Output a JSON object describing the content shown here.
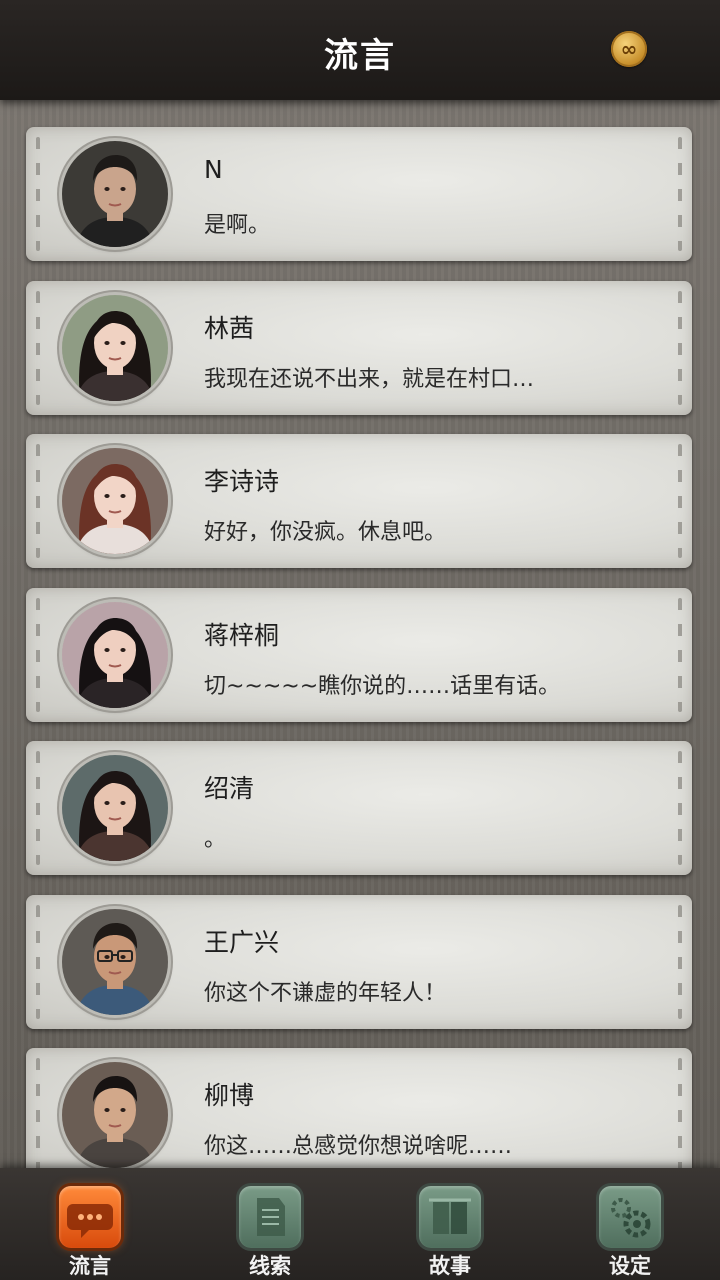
{
  "header": {
    "title": "流言",
    "coin_symbol": "∞",
    "coin_icon": "coin-infinity-icon"
  },
  "messages": [
    {
      "name": "N",
      "text": "是啊。",
      "avatar": "man-dark-portrait",
      "skin": "#c9a48c",
      "hair": "#1d1a18",
      "bg": "#3c3a36",
      "cloth": "#202020"
    },
    {
      "name": "林茜",
      "text": "我现在还说不出来，就是在村口…",
      "avatar": "woman-long-hair",
      "skin": "#f0d2c2",
      "hair": "#1a1412",
      "bg": "#8f9c84",
      "cloth": "#3a3030"
    },
    {
      "name": "李诗诗",
      "text": "好好，你没疯。休息吧。",
      "avatar": "woman-auburn-hair",
      "skin": "#f2d5c7",
      "hair": "#6b3326",
      "bg": "#7c6a62",
      "cloth": "#e8dfdb"
    },
    {
      "name": "蒋梓桐",
      "text": "切~~~~~瞧你说的……话里有话。",
      "avatar": "woman-black-hair",
      "skin": "#efcfc0",
      "hair": "#151112",
      "bg": "#b9a3a8",
      "cloth": "#2a2426"
    },
    {
      "name": "绍清",
      "text": "。",
      "avatar": "woman-side-hair",
      "skin": "#e8c4b0",
      "hair": "#1c1514",
      "bg": "#5d6b6a",
      "cloth": "#4b3530"
    },
    {
      "name": "王广兴",
      "text": "你这个不谦虚的年轻人！",
      "avatar": "man-glasses",
      "skin": "#c99878",
      "hair": "#1f1a17",
      "bg": "#5e5a55",
      "cloth": "#3c5a7a"
    },
    {
      "name": "柳博",
      "text": "你这……总感觉你想说啥呢……",
      "avatar": "man-short-hair",
      "skin": "#d2a88a",
      "hair": "#171312",
      "bg": "#6a5d54",
      "cloth": "#4a4440"
    }
  ],
  "tabs": [
    {
      "label": "流言",
      "icon": "chat-bubble-icon",
      "active": true
    },
    {
      "label": "线索",
      "icon": "notes-icon",
      "active": false
    },
    {
      "label": "故事",
      "icon": "book-icon",
      "active": false
    },
    {
      "label": "设定",
      "icon": "gear-icon",
      "active": false
    }
  ],
  "colors": {
    "active_tab": "#e8621c",
    "inactive_tab": "#628371",
    "header_bg": "#221f1d"
  }
}
